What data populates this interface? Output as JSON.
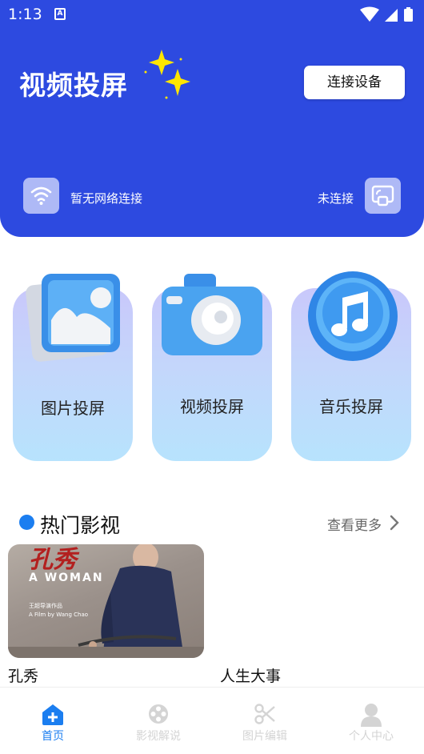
{
  "status_bar": {
    "time": "1:13",
    "notification_glyph": "A"
  },
  "header": {
    "title": "视频投屏",
    "connect_button": "连接设备",
    "network_status": "暂无网络连接",
    "cast_status": "未连接"
  },
  "cards": [
    {
      "label": "图片投屏",
      "icon": "image-icon"
    },
    {
      "label": "视频投屏",
      "icon": "camera-icon"
    },
    {
      "label": "音乐投屏",
      "icon": "music-icon"
    }
  ],
  "section": {
    "title": "热门影视",
    "more": "查看更多"
  },
  "movies": [
    {
      "name": "孔秀",
      "poster_title": "孔秀",
      "poster_subtitle": "A WOMAN",
      "poster_credit_1": "王超导演作品",
      "poster_credit_2": "A Film by Wang Chao"
    },
    {
      "name": "人生大事"
    }
  ],
  "bottom_nav": [
    {
      "label": "首页",
      "icon": "home-plus-icon",
      "active": true
    },
    {
      "label": "影视解说",
      "icon": "film-reel-icon",
      "active": false
    },
    {
      "label": "图片编辑",
      "icon": "scissors-icon",
      "active": false
    },
    {
      "label": "个人中心",
      "icon": "person-icon",
      "active": false
    }
  ],
  "colors": {
    "header_bg": "#2d4ae0",
    "accent": "#1b7ef0",
    "inactive_nav": "#d4d4d4",
    "sparkle": "#ffe600"
  }
}
